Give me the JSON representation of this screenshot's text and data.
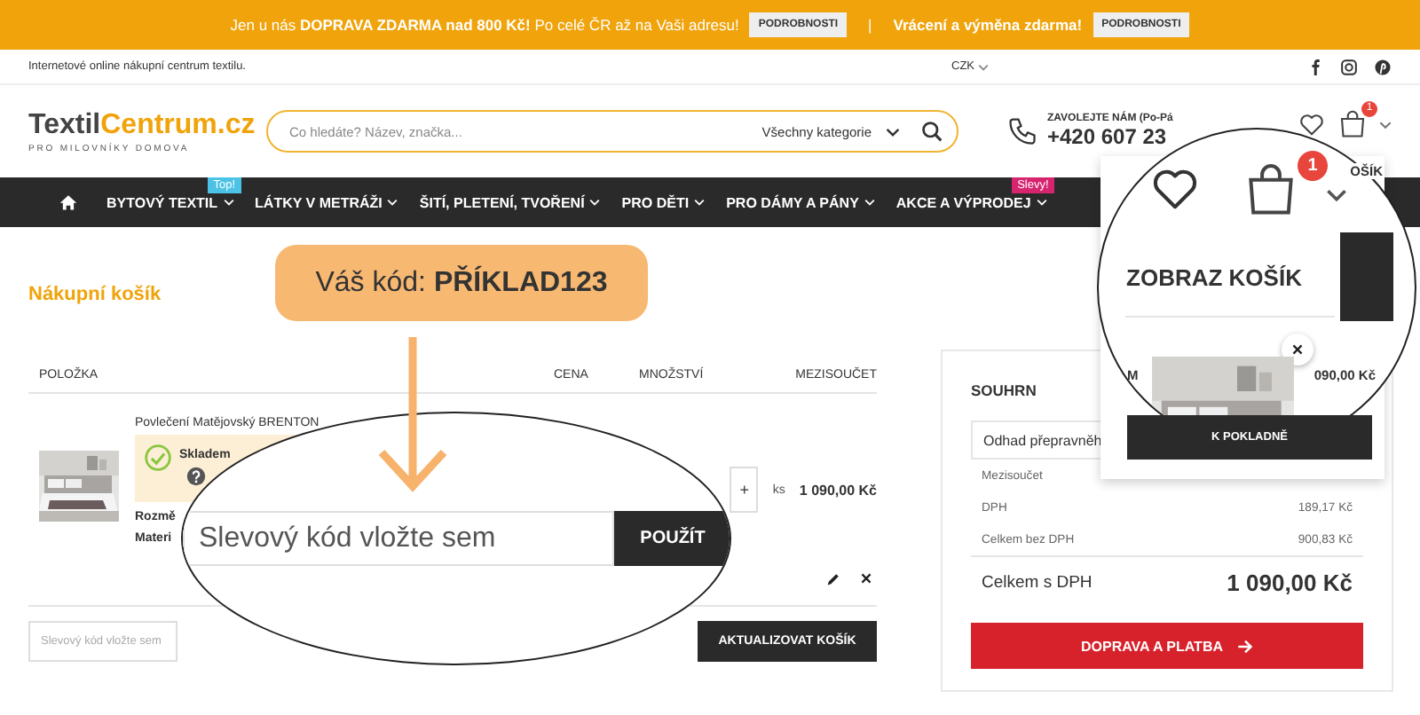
{
  "promo_bar": {
    "segments": [
      {
        "text": "Jen u nás **DOPRAVA ZDARMA nad 800 Kč!** Po celé ČR až na Vaši adresu!",
        "button": "PODROBNOSTI"
      },
      {
        "text": "**Vrácení a výměna zdarma!**",
        "button": "PODROBNOSTI"
      }
    ],
    "separator": "|"
  },
  "top_bar": {
    "tagline": "Internetové online nákupní centrum textilu.",
    "currency": "CZK"
  },
  "header": {
    "logo": {
      "part1": "Textil",
      "part2": "Centrum.cz",
      "slogan": "PRO MILOVNÍKY DOMOVA"
    },
    "search": {
      "placeholder": "Co hledáte? Název, značka...",
      "category": "Všechny kategorie"
    },
    "contact": {
      "label": "ZAVOLEJTE NÁM (Po-Pá",
      "phone": "+420 607 23"
    },
    "cart_count": "1"
  },
  "nav": {
    "items": [
      {
        "label": "BYTOVÝ TEXTIL",
        "badge": {
          "text": "Top!",
          "color": "#4cc3e6"
        }
      },
      {
        "label": "LÁTKY V METRÁŽI"
      },
      {
        "label": "ŠITÍ, PLETENÍ, TVOŘENÍ"
      },
      {
        "label": "PRO DĚTI"
      },
      {
        "label": "PRO DÁMY A PÁNY"
      },
      {
        "label": "AKCE A VÝPRODEJ",
        "badge": {
          "text": "Slevy!",
          "color": "#d6246e"
        }
      }
    ]
  },
  "cart": {
    "title": "Nákupní košík",
    "callout": "Váš kód: **PŘÍKLAD123**",
    "columns": [
      "POLOŽKA",
      "CENA",
      "MNOŽSTVÍ",
      "MEZISOUČET"
    ],
    "item": {
      "name": "Povlečení Matějovský BRENTON",
      "stock": "Skladem",
      "size_label": "Rozmě",
      "material_label": "Materi",
      "qty_plus": "+",
      "unit": "ks",
      "subtotal": "1 090,00 Kč"
    },
    "coupon": {
      "placeholder": "Slevový kód vložte sem"
    },
    "update_button": "AKTUALIZOVAT KOŠÍK"
  },
  "coupon_zoom": {
    "placeholder": "Slevový kód vložte sem",
    "button": "POUŽÍT"
  },
  "summary": {
    "title": "SOUHRN",
    "shipping": "Odhad přepravněh",
    "rows": [
      {
        "label": "Mezisoučet"
      },
      {
        "label": "DPH",
        "value": "189,17 Kč"
      },
      {
        "label": "Celkem bez DPH",
        "value": "900,83 Kč"
      }
    ],
    "total": {
      "label": "Celkem s DPH",
      "value": "1 090,00 Kč"
    },
    "button": "DOPRAVA A PLATBA"
  },
  "cart_dropdown": {
    "title_fragment": "OŠÍK",
    "label_fragment": "M",
    "price_fragment": "090,00 Kč",
    "checkout": "K POKLADNĚ"
  },
  "cart_zoom": {
    "cart_count": "1",
    "title": "ZOBRAZ KOŠÍK"
  }
}
